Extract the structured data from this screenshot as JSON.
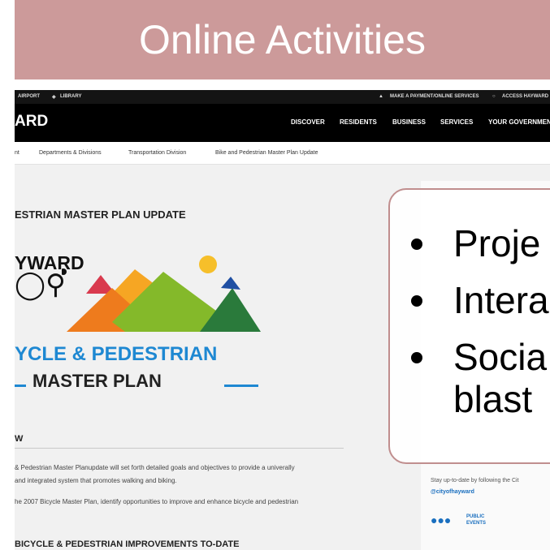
{
  "slide": {
    "title": "Online Activities",
    "bullets": [
      "Proje",
      "Intera",
      "Socia",
      "blast"
    ]
  },
  "site": {
    "topbar": {
      "left_items": [
        "AIRPORT",
        "LIBRARY"
      ],
      "right_items": [
        "MAKE A PAYMENT/ONLINE SERVICES",
        "ACCESS HAYWARD"
      ]
    },
    "logo_text": "ARD",
    "nav": [
      "DISCOVER",
      "RESIDENTS",
      "BUSINESS",
      "SERVICES",
      "YOUR GOVERNMEN"
    ],
    "breadcrumbs": [
      "nt",
      "Departments & Divisions",
      "Transportation Division",
      "Bike and Pedestrian Master Plan Update"
    ],
    "page_heading": "ESTRIAN MASTER PLAN UPDATE",
    "plan_logo": {
      "city": "YWARD",
      "line1": "YCLE & PEDESTRIAN",
      "line2": "MASTER PLAN"
    },
    "overview_heading": "W",
    "paragraphs": [
      "& Pedestrian Master Planupdate will set forth detailed goals and objectives to provide a univerally",
      "and integrated system that promotes walking and biking.",
      "he 2007 Bicycle Master Plan, identify opportunities to improve and enhance bicycle and pedestrian"
    ],
    "improvements_heading": "BICYCLE & PEDESTRIAN IMPROVEMENTS TO-DATE",
    "sidebar": {
      "stay_text": "Stay up-to-date by following the Cit",
      "handle": "@cityofhayward",
      "events_label": "PUBLIC EVENTS"
    }
  },
  "colors": {
    "title_banner": "#cc9a9a",
    "callout_border": "#c08e8e",
    "logo_blue": "#1e88d2",
    "link_blue": "#1a6fbf"
  }
}
